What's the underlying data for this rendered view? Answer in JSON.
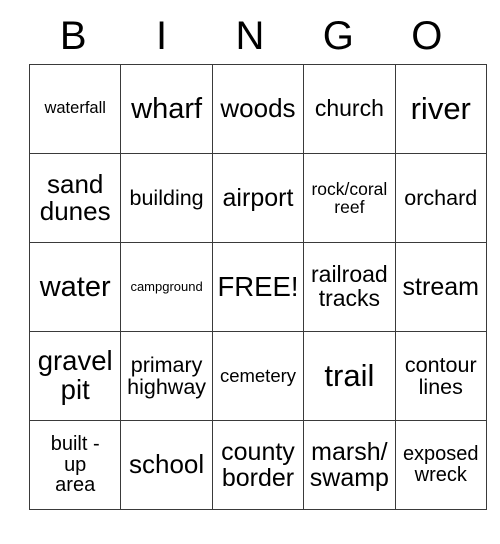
{
  "card": {
    "title": "BINGO",
    "header_letters": [
      "B",
      "I",
      "N",
      "G",
      "O"
    ],
    "free_space_label": "FREE!",
    "grid": [
      [
        {
          "label": "waterfall",
          "size": "fs-16",
          "lines": 1
        },
        {
          "label": "wharf",
          "size": "fs-29",
          "lines": 1
        },
        {
          "label": "woods",
          "size": "fs-26",
          "lines": 1
        },
        {
          "label": "church",
          "size": "fs-23",
          "lines": 1
        },
        {
          "label": "river",
          "size": "fs-31",
          "lines": 1
        }
      ],
      [
        {
          "label": "sand\ndunes",
          "size": "fs-26",
          "lines": 2
        },
        {
          "label": "building",
          "size": "fs-21",
          "lines": 1
        },
        {
          "label": "airport",
          "size": "fs-25",
          "lines": 1
        },
        {
          "label": "rock/coral\nreef",
          "size": "fs-17",
          "lines": 2
        },
        {
          "label": "orchard",
          "size": "fs-21",
          "lines": 1
        }
      ],
      [
        {
          "label": "water",
          "size": "fs-29",
          "lines": 1
        },
        {
          "label": "campground",
          "size": "fs-13",
          "lines": 1
        },
        {
          "label": "FREE!",
          "size": "fs-27",
          "lines": 1
        },
        {
          "label": "railroad\ntracks",
          "size": "fs-23",
          "lines": 2
        },
        {
          "label": "stream",
          "size": "fs-25",
          "lines": 1
        }
      ],
      [
        {
          "label": "gravel\npit",
          "size": "fs-27",
          "lines": 2
        },
        {
          "label": "primary\nhighway",
          "size": "fs-21",
          "lines": 2
        },
        {
          "label": "cemetery",
          "size": "fs-18",
          "lines": 1
        },
        {
          "label": "trail",
          "size": "fs-31",
          "lines": 1
        },
        {
          "label": "contour\nlines",
          "size": "fs-21",
          "lines": 2
        }
      ],
      [
        {
          "label": "built -\nup\narea",
          "size": "fs-20",
          "lines": 3
        },
        {
          "label": "school",
          "size": "fs-26",
          "lines": 1
        },
        {
          "label": "county\nborder",
          "size": "fs-25",
          "lines": 2
        },
        {
          "label": "marsh/\nswamp",
          "size": "fs-25",
          "lines": 2
        },
        {
          "label": "exposed\nwreck",
          "size": "fs-20",
          "lines": 2
        }
      ]
    ]
  },
  "colors": {
    "background": "#ffffff",
    "text": "#000000",
    "border": "#3a3a3a"
  }
}
